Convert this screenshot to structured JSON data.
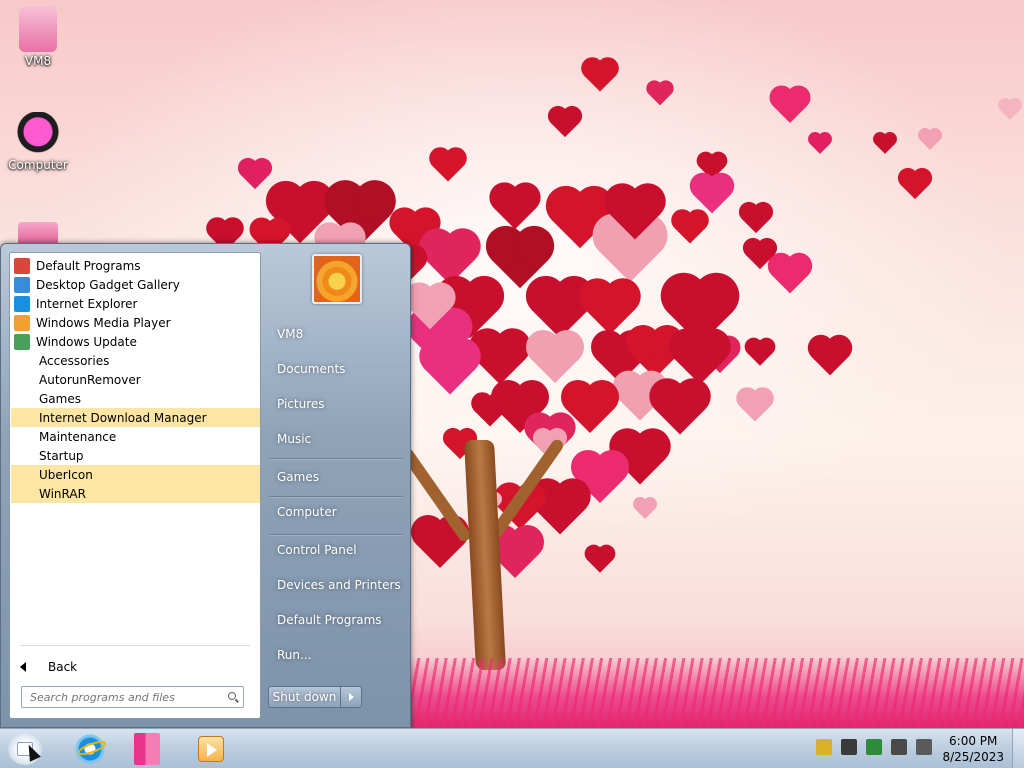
{
  "desktop": {
    "icons": [
      {
        "label": "VM8",
        "icon": "user-doll-icon"
      },
      {
        "label": "Computer",
        "icon": "computer-icon"
      },
      {
        "label": "",
        "icon": "recycle-bin-icon"
      }
    ]
  },
  "start_menu": {
    "programs": [
      {
        "label": "Default Programs",
        "icon": "default-programs-icon",
        "type": "app",
        "highlight": false,
        "color": "#d9473a"
      },
      {
        "label": "Desktop Gadget Gallery",
        "icon": "gadget-gallery-icon",
        "type": "app",
        "highlight": false,
        "color": "#3a8bd9"
      },
      {
        "label": "Internet Explorer",
        "icon": "internet-explorer-icon",
        "type": "app",
        "highlight": false,
        "color": "#1a8fe0"
      },
      {
        "label": "Windows Media Player",
        "icon": "media-player-icon",
        "type": "app",
        "highlight": false,
        "color": "#f0a030"
      },
      {
        "label": "Windows Update",
        "icon": "windows-update-icon",
        "type": "app",
        "highlight": false,
        "color": "#4aa05a"
      },
      {
        "label": "Accessories",
        "icon": "folder-icon",
        "type": "folder",
        "highlight": false
      },
      {
        "label": "AutorunRemover",
        "icon": "folder-icon",
        "type": "folder",
        "highlight": false
      },
      {
        "label": "Games",
        "icon": "folder-icon",
        "type": "folder",
        "highlight": false
      },
      {
        "label": "Internet Download Manager",
        "icon": "folder-icon",
        "type": "folder",
        "highlight": true
      },
      {
        "label": "Maintenance",
        "icon": "folder-icon",
        "type": "folder",
        "highlight": false
      },
      {
        "label": "Startup",
        "icon": "folder-icon",
        "type": "folder",
        "highlight": false
      },
      {
        "label": "UberIcon",
        "icon": "folder-icon",
        "type": "folder",
        "highlight": true
      },
      {
        "label": "WinRAR",
        "icon": "folder-icon",
        "type": "folder",
        "highlight": true
      }
    ],
    "back_label": "Back",
    "search_placeholder": "Search programs and files",
    "right_items": [
      {
        "label": "VM8",
        "id": "user-folder"
      },
      {
        "label": "Documents",
        "id": "documents"
      },
      {
        "label": "Pictures",
        "id": "pictures"
      },
      {
        "label": "Music",
        "id": "music"
      },
      {
        "label": "Games",
        "id": "games"
      },
      {
        "label": "Computer",
        "id": "computer"
      },
      {
        "label": "Control Panel",
        "id": "control-panel"
      },
      {
        "label": "Devices and Printers",
        "id": "devices-and-printers"
      },
      {
        "label": "Default Programs",
        "id": "default-programs"
      },
      {
        "label": "Run...",
        "id": "run"
      }
    ],
    "shutdown_label": "Shut down"
  },
  "taskbar": {
    "pinned": [
      {
        "icon": "internet-explorer-icon"
      },
      {
        "icon": "windows-explorer-icon"
      },
      {
        "icon": "media-player-icon"
      }
    ],
    "tray": [
      {
        "icon": "security-shield-icon",
        "color": "#d9b225"
      },
      {
        "icon": "download-manager-icon",
        "color": "#3a3a3a"
      },
      {
        "icon": "safely-remove-icon",
        "color": "#2e8b3a"
      },
      {
        "icon": "network-icon",
        "color": "#4a4a4a"
      },
      {
        "icon": "volume-muted-icon",
        "color": "#5a5a5a"
      }
    ],
    "clock_time": "6:00 PM",
    "clock_date": "8/25/2023"
  },
  "colors": {
    "highlight": "#fde5a3",
    "accent_pink": "#e8348c"
  }
}
